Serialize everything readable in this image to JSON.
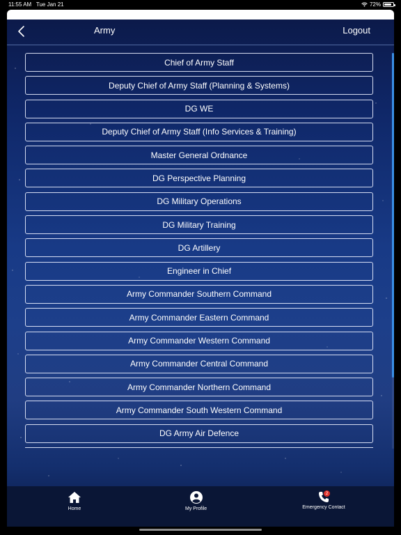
{
  "status_bar": {
    "time": "11:55 AM",
    "date": "Tue Jan 21",
    "battery": "72%",
    "icons": [
      "wifi-icon",
      "battery-icon"
    ]
  },
  "nav": {
    "title": "Army",
    "logout_label": "Logout",
    "back_icon": "chevron-left-icon"
  },
  "list": {
    "items": [
      "Chief of Army Staff",
      "Deputy Chief of Army Staff (Planning & Systems)",
      "DG WE",
      "Deputy Chief of Army Staff (Info Services & Training)",
      "Master General Ordnance",
      "DG Perspective Planning",
      "DG Military Operations",
      "DG Military Training",
      "DG Artillery",
      "Engineer in Chief",
      "Army Commander Southern Command",
      "Army Commander Eastern Command",
      "Army Commander Western Command",
      "Army Commander Central Command",
      "Army Commander Northern Command",
      "Army Commander South Western Command",
      "DG Army Air Defence"
    ]
  },
  "tab_bar": {
    "home": {
      "label": "Home",
      "icon": "home-icon"
    },
    "profile": {
      "label": "My Profile",
      "icon": "user-circle-icon"
    },
    "emergency": {
      "label": "Emergency Contact",
      "icon": "phone-icon",
      "badge": "2"
    }
  },
  "colors": {
    "accent_scrollbar": "#3a8fe6",
    "badge": "#e0322b",
    "background_top": "#0c1a4a",
    "background_mid": "#1d3f8a"
  }
}
